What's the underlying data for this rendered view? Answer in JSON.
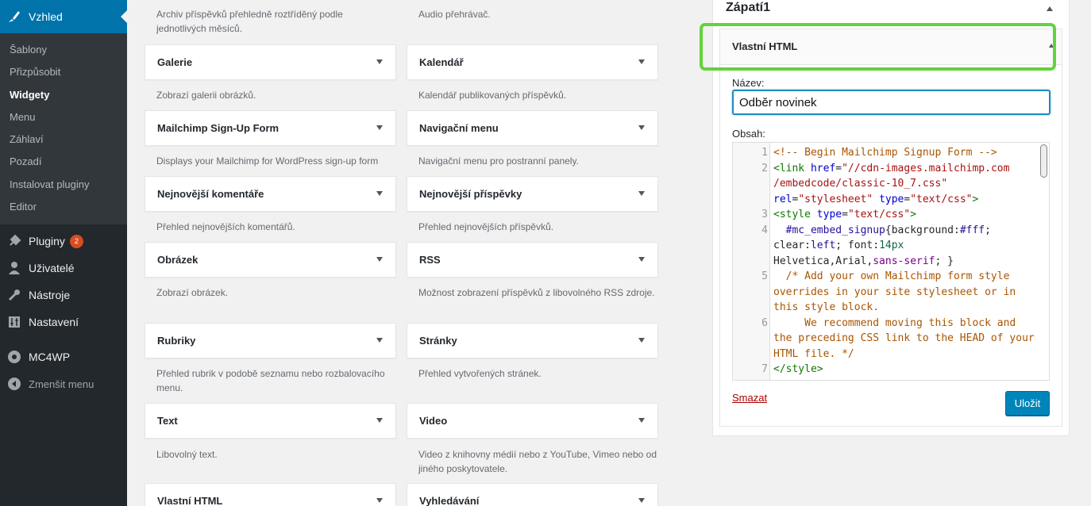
{
  "admin_menu": {
    "current": "Vzhled",
    "submenu": [
      "Šablony",
      "Přizpůsobit",
      "Widgety",
      "Menu",
      "Záhlaví",
      "Pozadí",
      "Instalovat pluginy",
      "Editor"
    ],
    "items": [
      {
        "label": "Pluginy",
        "badge": "2",
        "icon": "plugins-icon"
      },
      {
        "label": "Uživatelé",
        "icon": "users-icon"
      },
      {
        "label": "Nástroje",
        "icon": "tools-icon"
      },
      {
        "label": "Nastavení",
        "icon": "settings-icon"
      },
      {
        "label": "MC4WP",
        "icon": "mc4wp-icon"
      },
      {
        "label": "Zmenšit menu",
        "icon": "collapse-icon"
      }
    ]
  },
  "available_widgets": {
    "top_desc_left": "Archiv příspěvků přehledně roztříděný podle jednotlivých měsíců.",
    "top_desc_right": "Audio přehrávač.",
    "rows": [
      [
        {
          "title": "Galerie",
          "desc": "Zobrazí galerii obrázků."
        },
        {
          "title": "Kalendář",
          "desc": "Kalendář publikovaných příspěvků."
        }
      ],
      [
        {
          "title": "Mailchimp Sign-Up Form",
          "desc": "Displays your Mailchimp for WordPress sign-up form"
        },
        {
          "title": "Navigační menu",
          "desc": "Navigační menu pro postranní panely."
        }
      ],
      [
        {
          "title": "Nejnovější komentáře",
          "desc": "Přehled nejnovějších komentářů."
        },
        {
          "title": "Nejnovější příspěvky",
          "desc": "Přehled nejnovějších příspěvků."
        }
      ],
      [
        {
          "title": "Obrázek",
          "desc": "Zobrazí obrázek."
        },
        {
          "title": "RSS",
          "desc": "Možnost zobrazení příspěvků z libovolného RSS zdroje."
        }
      ],
      [
        {
          "title": "Rubriky",
          "desc": "Přehled rubrik v podobě seznamu nebo rozbalovacího menu."
        },
        {
          "title": "Stránky",
          "desc": "Přehled vytvořených stránek."
        }
      ],
      [
        {
          "title": "Text",
          "desc": "Libovolný text."
        },
        {
          "title": "Video",
          "desc": "Video z knihovny médií nebo z YouTube, Vimeo nebo od jiného poskytovatele."
        }
      ],
      [
        {
          "title": "Vlastní HTML",
          "desc": ""
        },
        {
          "title": "Vyhledávání",
          "desc": ""
        }
      ]
    ]
  },
  "sidebar_area": {
    "title": "Zápatí1",
    "widget": {
      "title": "Vlastní HTML",
      "name_label": "Název:",
      "name_value": "Odběr novinek",
      "content_label": "Obsah:",
      "delete_label": "Smazat",
      "save_label": "Uložit"
    }
  },
  "code_lines": [
    {
      "n": "1",
      "tokens": [
        [
          "c-com",
          "<!-- Begin Mailchimp Signup Form -->"
        ]
      ]
    },
    {
      "n": "2",
      "tokens": [
        [
          "c-tag",
          "<link "
        ],
        [
          "c-att",
          "href"
        ],
        [
          "",
          "="
        ],
        [
          "c-str",
          "\"//cdn-images.mailchimp.com"
        ]
      ]
    },
    {
      "n": "",
      "tokens": [
        [
          "c-str",
          "/embedcode/classic-10_7.css\""
        ]
      ]
    },
    {
      "n": "",
      "tokens": [
        [
          "c-att",
          "rel"
        ],
        [
          "",
          "="
        ],
        [
          "c-str",
          "\"stylesheet\""
        ],
        [
          "",
          " "
        ],
        [
          "c-att",
          "type"
        ],
        [
          "",
          "="
        ],
        [
          "c-str",
          "\"text/css\""
        ],
        [
          "c-tag",
          ">"
        ]
      ]
    },
    {
      "n": "3",
      "tokens": [
        [
          "c-tag",
          "<style "
        ],
        [
          "c-att",
          "type"
        ],
        [
          "",
          "="
        ],
        [
          "c-str",
          "\"text/css\""
        ],
        [
          "c-tag",
          ">"
        ]
      ]
    },
    {
      "n": "4",
      "tokens": [
        [
          "",
          "  "
        ],
        [
          "c-def",
          "#mc_embed_signup"
        ],
        [
          "",
          "{background:"
        ],
        [
          "c-def",
          "#fff"
        ],
        [
          "",
          ";"
        ]
      ]
    },
    {
      "n": "",
      "tokens": [
        [
          "",
          "clear:"
        ],
        [
          "c-def",
          "left"
        ],
        [
          "",
          "; font:"
        ],
        [
          "c-num",
          "14px"
        ]
      ]
    },
    {
      "n": "",
      "tokens": [
        [
          "",
          "Helvetica,Arial,"
        ],
        [
          "c-kw",
          "sans-serif"
        ],
        [
          "",
          "; }"
        ]
      ]
    },
    {
      "n": "5",
      "tokens": [
        [
          "c-com",
          "  /* Add your own Mailchimp form style"
        ]
      ]
    },
    {
      "n": "",
      "tokens": [
        [
          "c-com",
          "overrides in your site stylesheet or in"
        ]
      ]
    },
    {
      "n": "",
      "tokens": [
        [
          "c-com",
          "this style block."
        ]
      ]
    },
    {
      "n": "6",
      "tokens": [
        [
          "c-com",
          "     We recommend moving this block and"
        ]
      ]
    },
    {
      "n": "",
      "tokens": [
        [
          "c-com",
          "the preceding CSS link to the HEAD of your"
        ]
      ]
    },
    {
      "n": "",
      "tokens": [
        [
          "c-com",
          "HTML file. */"
        ]
      ]
    },
    {
      "n": "7",
      "tokens": [
        [
          "c-tag",
          "</style>"
        ]
      ]
    }
  ]
}
